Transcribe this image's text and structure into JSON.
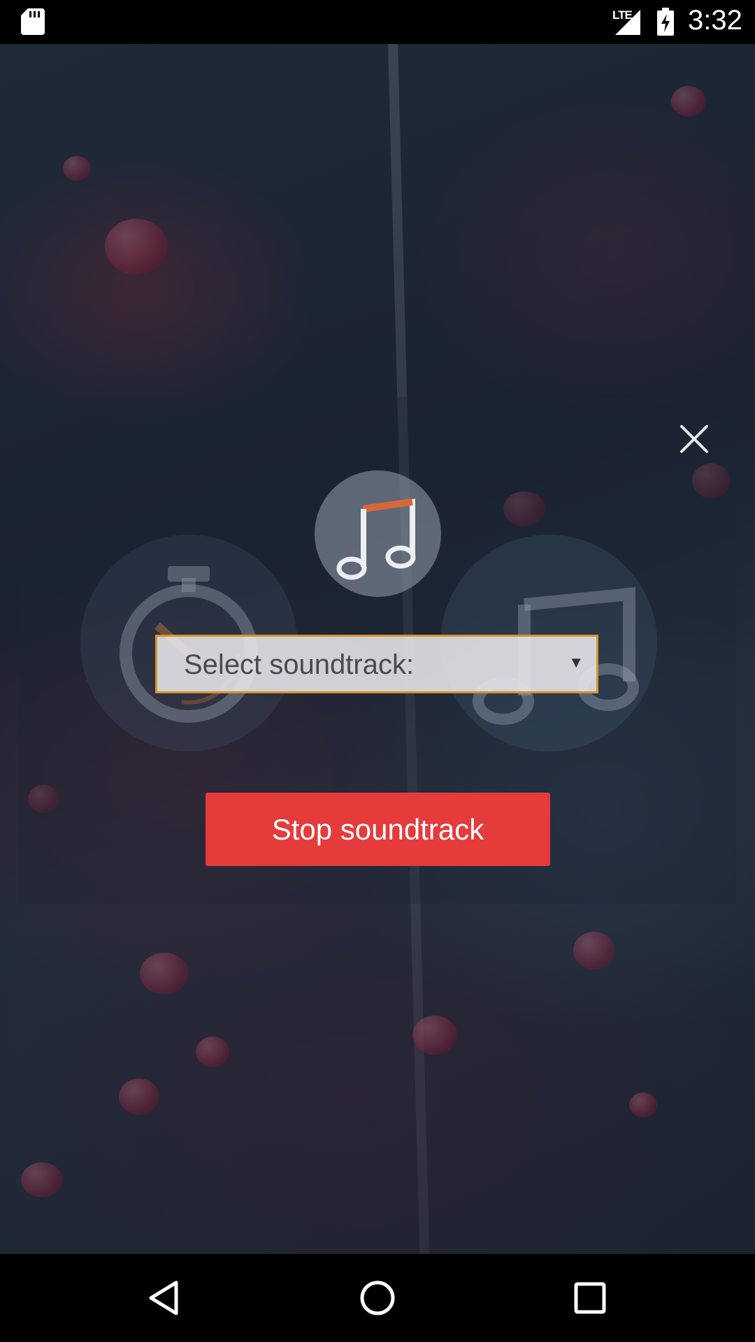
{
  "status_bar": {
    "network_type": "LTE",
    "time": "3:32",
    "icons": [
      "sd-card-icon",
      "signal-icon",
      "battery-charging-icon"
    ]
  },
  "dialog": {
    "close_icon": "close-icon",
    "header_icon": "music-note-icon",
    "select": {
      "placeholder": "Select soundtrack:",
      "arrow": "▼"
    },
    "stop_button_label": "Stop soundtrack",
    "accent_color": "#d8922a",
    "button_color": "#e53b3b"
  },
  "nav_bar": {
    "icons": [
      "back-icon",
      "home-icon",
      "recents-icon"
    ]
  }
}
